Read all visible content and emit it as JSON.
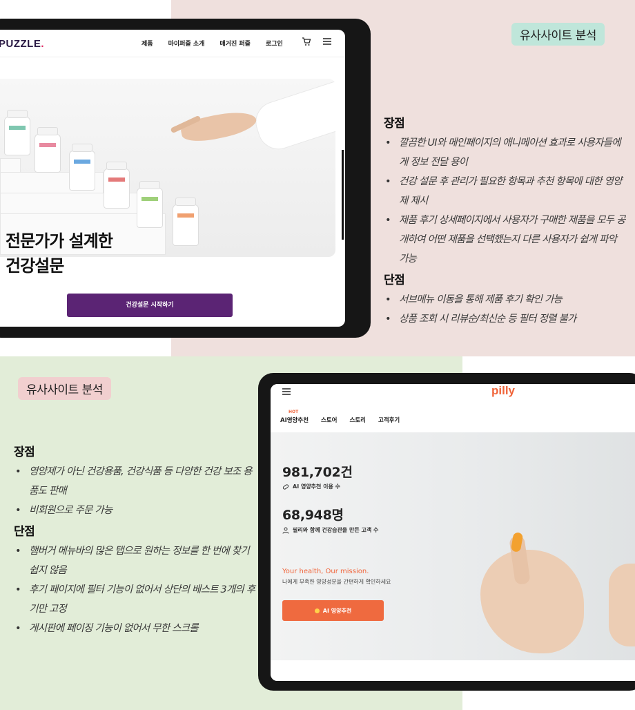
{
  "top_section": {
    "badge": "유사사이트 분석",
    "site": {
      "logo": "PUZZLE",
      "logo_dot": ".",
      "nav": [
        "제품",
        "마이퍼즐 소개",
        "매거진 퍼즐",
        "로그인"
      ],
      "icons": [
        "cart-icon",
        "hamburger-menu-icon"
      ],
      "headline_line1": "전문가가 설계한",
      "headline_line2": "건강설문",
      "cta": "건강설문 시작하기"
    },
    "pros_title": "장점",
    "pros": [
      "깔끔한 UI와 메인페이지의 애니메이션 효과로 사용자들에게 정보 전달 용이",
      "건강 설문 후 관리가 필요한 항목과 추천 항목에 대한 영양제 제시",
      "제품 후기 상세페이지에서 사용자가 구매한 제품을 모두 공개하여 어떤 제품을 선택했는지 다른 사용자가 쉽게 파악 가능"
    ],
    "cons_title": "단점",
    "cons": [
      "서브메뉴 이동을 통해 제품 후기 확인 가능",
      "상품 조회 시 리뷰순/최신순 등 필터 정렬 불가"
    ]
  },
  "bottom_section": {
    "badge": "유사사이트 분석",
    "site": {
      "logo": "pilly",
      "tabs": [
        "AI영양추천",
        "스토어",
        "스토리",
        "고객후기"
      ],
      "hot": "HOT",
      "stat1_value": "981,702건",
      "stat1_label": "AI 영양추천 이용 수",
      "stat2_value": "68,948명",
      "stat2_label": "필리와 함께 건강습관을 만든 고객 수",
      "tagline": "Your health, Our mission.",
      "subtitle": "나에게 부족한 영양성분을 간편하게 확인하세요",
      "cta": "AI 영양추천"
    },
    "pros_title": "장점",
    "pros": [
      "영양제가 아닌 건강용품, 건강식품 등 다양한 건강 보조 용품도 판매",
      "비회원으로 주문 가능"
    ],
    "cons_title": "단점",
    "cons": [
      "햄버거 메뉴바의 많은 탭으로 원하는 정보를 한 번에 찾기 쉽지 않음",
      "후기 페이지에 필터 기능이 없어서 상단의 베스트 3개의 후기만 고정",
      "게시판에 페이징 기능이 없어서 무한 스크롤"
    ]
  },
  "colors": {
    "pink_bg": "#efe0dd",
    "green_bg": "#e2edd8",
    "puzzle_purple": "#5b2474",
    "pilly_orange": "#ef6a3f"
  }
}
